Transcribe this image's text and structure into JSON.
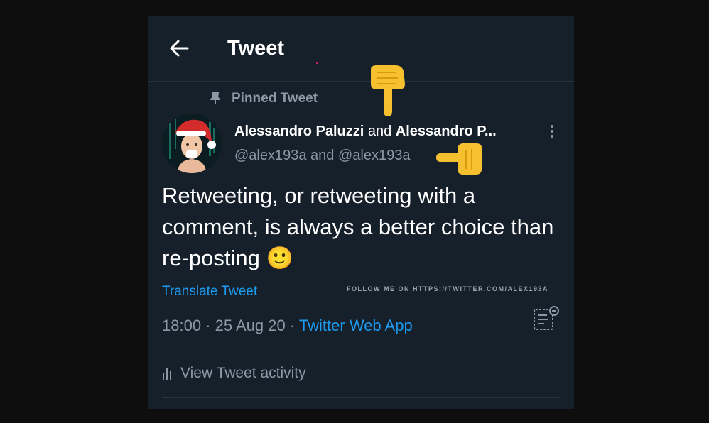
{
  "header": {
    "title": "Tweet",
    "back_icon": "arrow-left-icon"
  },
  "tweet": {
    "pinned_label": "Pinned Tweet",
    "author_1": "Alessandro Paluzzi",
    "and_text": "and",
    "author_2": "Alessandro P...",
    "handles": "@alex193a and @alex193a",
    "text": "Retweeting, or retweeting with a comment, is always a better choice than re-posting",
    "emoji": "🙂",
    "translate_label": "Translate Tweet",
    "watermark": "FOLLOW ME ON HTTPS://TWITTER.COM/ALEX193A",
    "time": "18:00",
    "separator": "·",
    "date": "25 Aug 20",
    "source": "Twitter Web App",
    "activity_label": "View Tweet activity"
  },
  "colors": {
    "background": "#15202b",
    "accent": "#1d9bf0",
    "secondary_text": "#8b98a5"
  }
}
